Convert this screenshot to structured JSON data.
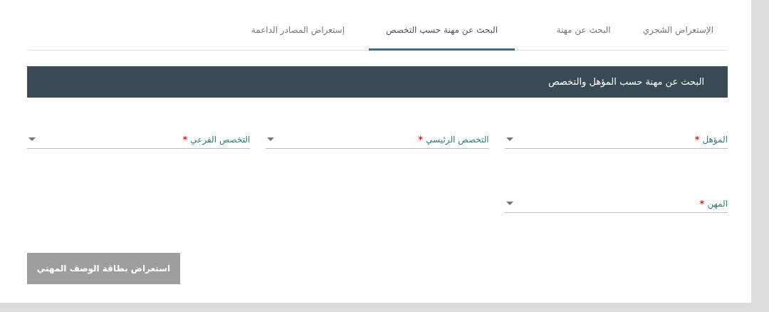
{
  "tabs": [
    {
      "label": "الإستعراض الشجري",
      "selected": false
    },
    {
      "label": "البحث عن مهنة",
      "selected": false
    },
    {
      "label": "البحث عن مهنة حسب التخصص",
      "selected": true
    },
    {
      "label": "إستعراض المصادر الداعمة",
      "selected": false
    }
  ],
  "panel": {
    "title": "البحث عن مهنة حسب المؤهل والتخصص"
  },
  "fields": [
    {
      "label": "المؤهل",
      "required": true
    },
    {
      "label": "التخصص الرئيسي",
      "required": true
    },
    {
      "label": "التخصص الفرعي",
      "required": true
    },
    {
      "label": "المهن",
      "required": true
    }
  ],
  "required_mark": "*",
  "button": {
    "label": "استعراض بطاقة الوصف المهني",
    "disabled": true
  }
}
